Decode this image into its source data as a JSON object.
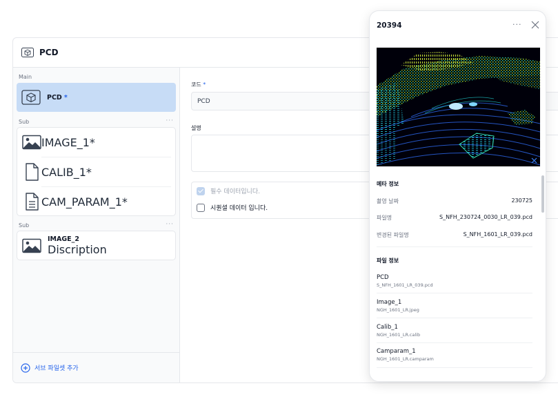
{
  "window": {
    "title": "PCD",
    "title_icon": "cube-icon"
  },
  "sidebar": {
    "main_label": "Main",
    "main_item": {
      "name": "PCD",
      "required": "*",
      "icon": "cube-icon"
    },
    "groups": [
      {
        "label": "Sub",
        "more": "···",
        "items": [
          {
            "name": "IMAGE_1",
            "required": "*",
            "icon": "image-icon"
          },
          {
            "name": "CALIB_1",
            "required": "*",
            "icon": "file-icon"
          },
          {
            "name": "CAM_PARAM_1",
            "required": "*",
            "icon": "document-icon"
          }
        ]
      },
      {
        "label": "Sub",
        "more": "···",
        "items": [
          {
            "name": "IMAGE_2",
            "description": "Discription",
            "icon": "image-icon"
          }
        ]
      }
    ],
    "add_label": "서브 파일셋 추가"
  },
  "form": {
    "code_label": "코드",
    "code_required": "*",
    "code_value": "PCD",
    "desc_label": "설명",
    "desc_value": "",
    "check_required_label": "필수 데이터입니다.",
    "check_required_checked": true,
    "check_sequential_label": "시퀀셜 데이터 입니다.",
    "check_sequential_checked": false
  },
  "panel": {
    "title": "20394",
    "more": "···",
    "meta_title": "메타 정보",
    "meta": [
      {
        "key": "촬영 날짜",
        "value": "230725"
      },
      {
        "key": "파일명",
        "value": "S_NFH_230724_0030_LR_039.pcd"
      },
      {
        "key": "변경된 파일명",
        "value": "S_NFH_1601_LR_039.pcd"
      }
    ],
    "files_title": "파일 정보",
    "files": [
      {
        "name": "PCD",
        "file": "S_NFH_1601_LR_039.pcd"
      },
      {
        "name": "Image_1",
        "file": "NGH_1601_LR.jpeg"
      },
      {
        "name": "Calib_1",
        "file": "NGH_1601_LR.calib"
      },
      {
        "name": "Camparam_1",
        "file": "NGH_1601_LR.camparam"
      }
    ]
  },
  "colors": {
    "accent": "#2563eb",
    "selected_bg": "#c7dcf6",
    "border": "#e5e7eb"
  }
}
